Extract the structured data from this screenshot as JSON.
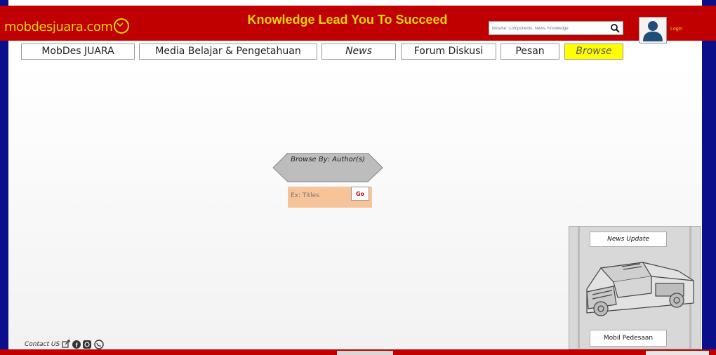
{
  "header": {
    "logo_text": "mobdesjuara.com",
    "tagline": "Knowledge Lead You To Succeed",
    "search_placeholder": "Browse: Components, News, Knowledge",
    "login_label": "Login"
  },
  "nav": [
    {
      "label": "MobDes JUARA"
    },
    {
      "label": "Media Belajar & Pengetahuan"
    },
    {
      "label": "News"
    },
    {
      "label": "Forum Diskusi"
    },
    {
      "label": "Pesan"
    },
    {
      "label": "Browse"
    }
  ],
  "browse": {
    "title": "Browse By: Author(s)",
    "input_placeholder": "Ex: Titles",
    "go_label": "Go"
  },
  "news": {
    "update_label": "News Update",
    "mobil_label": "Mobil Pedesaan"
  },
  "footer": {
    "contact_label": "Contact US"
  },
  "colors": {
    "header_bg": "#c00000",
    "side_border": "#0c0f8a",
    "accent_text": "#e8d400",
    "active_tab": "#ffff00"
  }
}
